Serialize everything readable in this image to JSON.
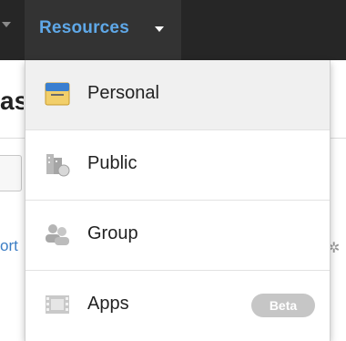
{
  "nav": {
    "resources_label": "Resources"
  },
  "background": {
    "heading_fragment": "as",
    "link_fragment": "ort",
    "gear_icon": "gear-icon"
  },
  "menu": {
    "items": [
      {
        "label": "Personal",
        "icon": "personal-folder-icon",
        "active": true
      },
      {
        "label": "Public",
        "icon": "public-building-icon",
        "active": false
      },
      {
        "label": "Group",
        "icon": "group-users-icon",
        "active": false
      },
      {
        "label": "Apps",
        "icon": "apps-film-icon",
        "active": false,
        "badge": "Beta"
      }
    ]
  },
  "colors": {
    "navbar": "#262626",
    "nav_active": "#333333",
    "nav_label": "#5fa8e8",
    "active_item": "#f0f0f0",
    "badge": "#c6c6c6"
  }
}
